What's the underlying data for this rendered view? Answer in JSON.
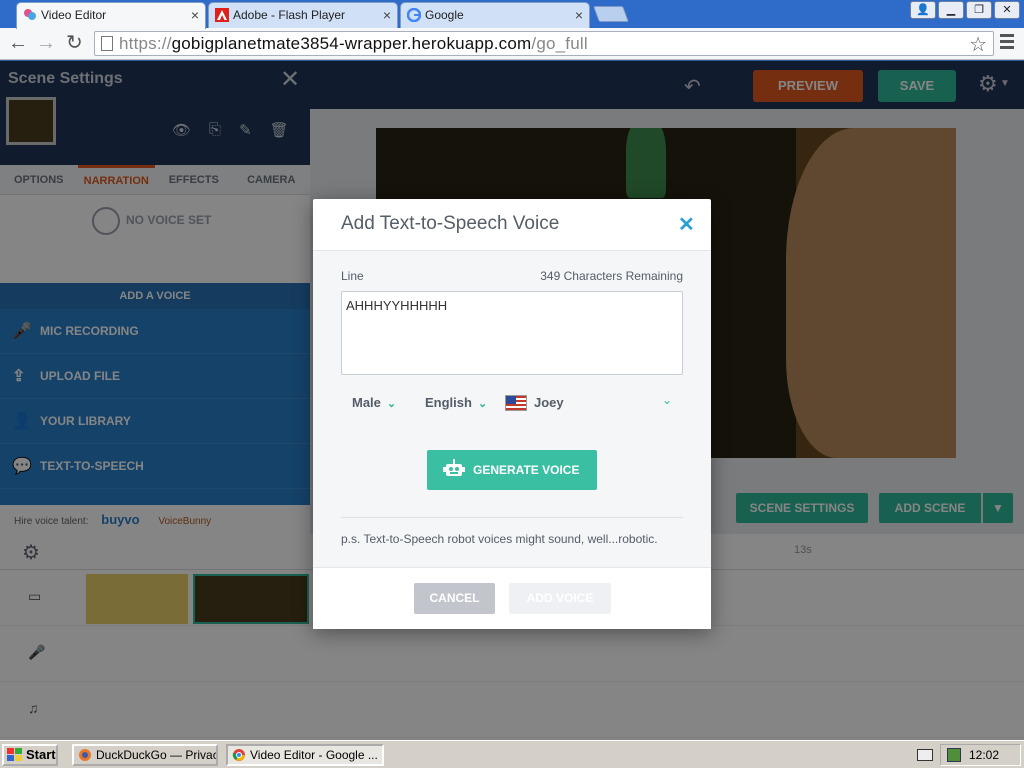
{
  "browser": {
    "tabs": [
      {
        "label": "Video Editor",
        "active": true
      },
      {
        "label": "Adobe - Flash Player",
        "active": false
      },
      {
        "label": "Google",
        "active": false
      }
    ],
    "url_prefix": "https://",
    "url_host": "gobigplanetmate3854-wrapper.herokuapp.com",
    "url_path": "/go_full"
  },
  "app": {
    "preview_label": "PREVIEW",
    "save_label": "SAVE",
    "sidebar": {
      "title": "Scene Settings",
      "tabs": [
        "OPTIONS",
        "NARRATION",
        "EFFECTS",
        "CAMERA"
      ],
      "no_voice": "NO VOICE SET",
      "add_voice_title": "ADD A VOICE",
      "voice_options": [
        "MIC RECORDING",
        "UPLOAD FILE",
        "YOUR LIBRARY",
        "TEXT-TO-SPEECH"
      ],
      "hire_label": "Hire voice talent:",
      "hire_brand_1": "buyvo",
      "hire_brand_2": "VoiceBunny"
    },
    "scene_settings_label": "SCENE SETTINGS",
    "add_scene_label": "ADD SCENE",
    "timeline_time": "13s"
  },
  "modal": {
    "title": "Add Text-to-Speech Voice",
    "line_label": "Line",
    "remaining": "349 Characters Remaining",
    "line_value": "AHHHYYHHHHH",
    "gender": "Male",
    "language": "English",
    "voice": "Joey",
    "generate_label": "GENERATE VOICE",
    "ps_note": "p.s. Text-to-Speech robot voices might sound, well...robotic.",
    "cancel_label": "CANCEL",
    "add_voice_label": "ADD VOICE"
  },
  "taskbar": {
    "start_label": "Start",
    "tasks": [
      "DuckDuckGo — Privac...",
      "Video Editor - Google ..."
    ],
    "clock": "12:02 PM"
  },
  "colors": {
    "accent_teal": "#3bbfa3",
    "preview_orange": "#e05b1f",
    "close_blue": "#2a9fd6"
  }
}
